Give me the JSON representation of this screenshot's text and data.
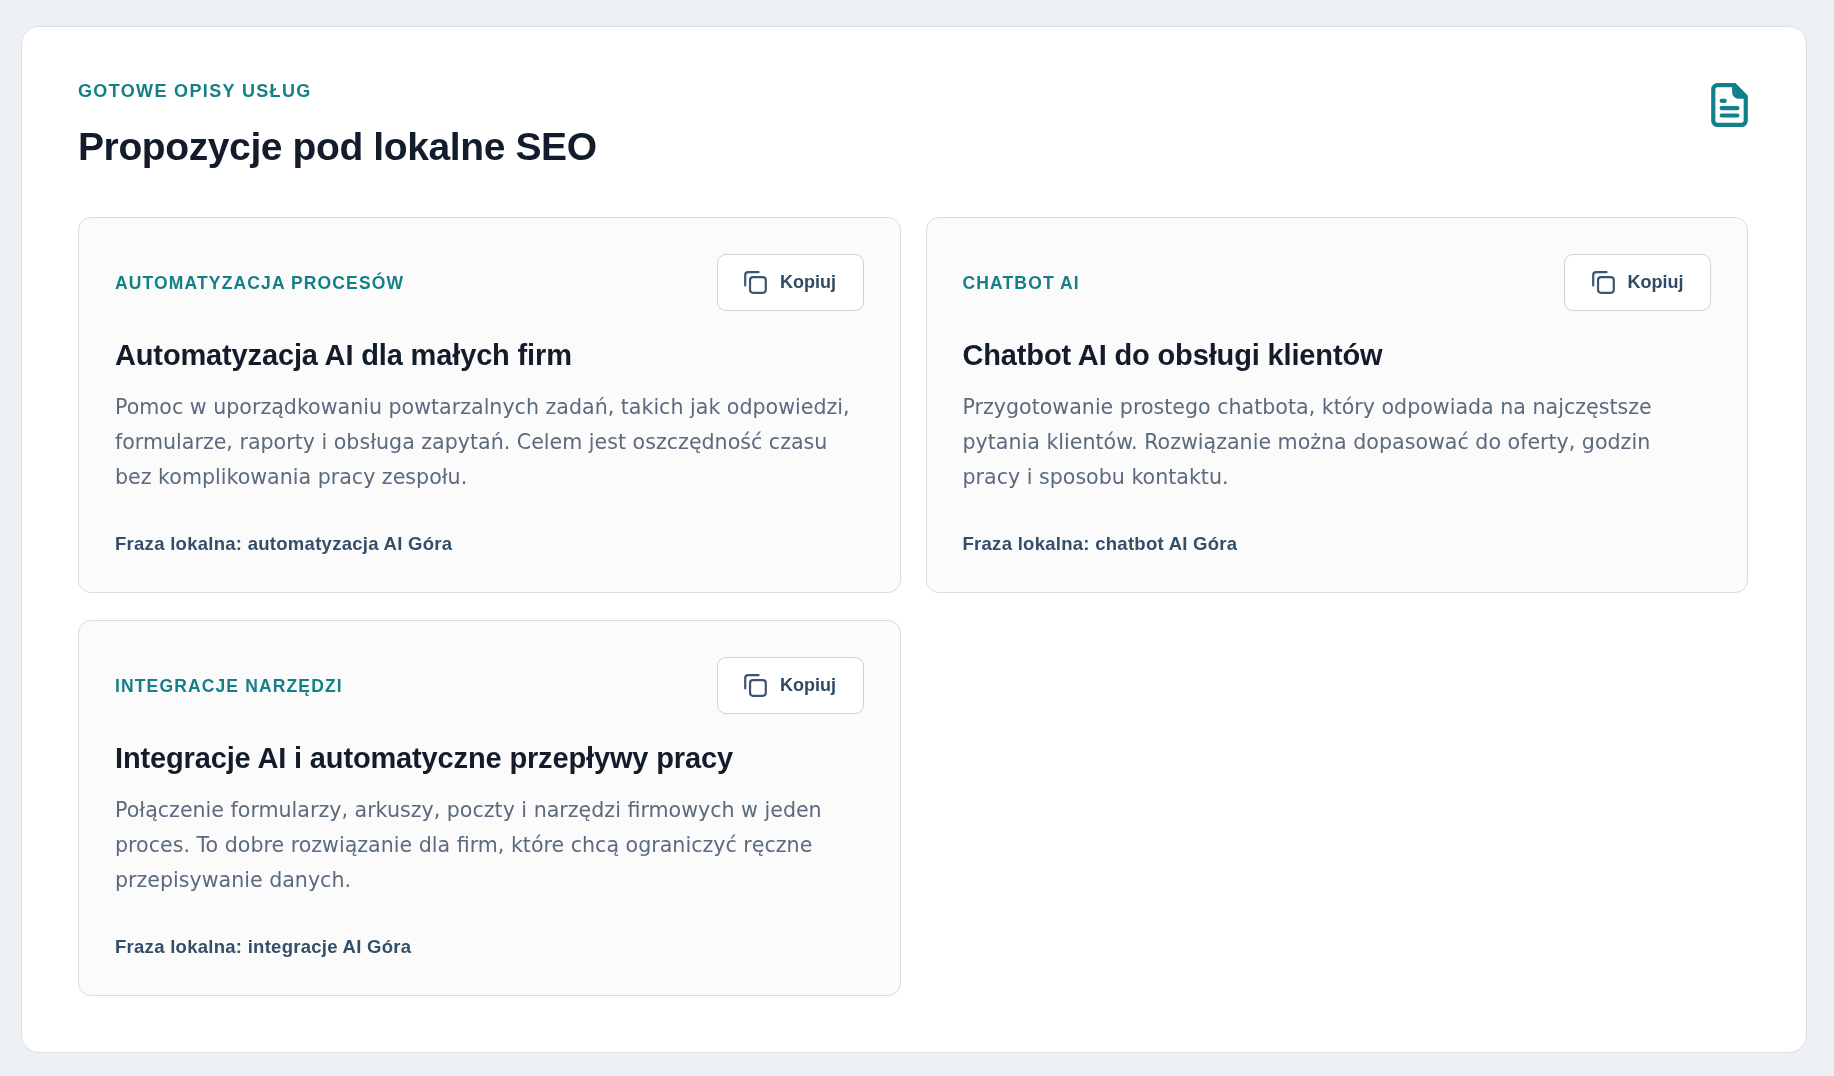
{
  "header": {
    "eyebrow": "GOTOWE OPISY USŁUG",
    "title": "Propozycje pod lokalne SEO"
  },
  "cards": [
    {
      "category": "AUTOMATYZACJA PROCESÓW",
      "button": "Kopiuj",
      "title": "Automatyzacja AI dla małych firm",
      "description": "Pomoc w uporządkowaniu powtarzalnych zadań, takich jak odpowiedzi, formularze, raporty i obsługa zapytań. Celem jest oszczędność czasu bez komplikowania pracy zespołu.",
      "phrase": "Fraza lokalna: automatyzacja AI Góra"
    },
    {
      "category": "CHATBOT AI",
      "button": "Kopiuj",
      "title": "Chatbot AI do obsługi klientów",
      "description": "Przygotowanie prostego chatbota, który odpowiada na najczęstsze pytania klientów. Rozwiązanie można dopasować do oferty, godzin pracy i sposobu kontaktu.",
      "phrase": "Fraza lokalna: chatbot AI Góra"
    },
    {
      "category": "INTEGRACJE NARZĘDZI",
      "button": "Kopiuj",
      "title": "Integracje AI i automatyczne przepływy pracy",
      "description": "Połączenie formularzy, arkuszy, poczty i narzędzi firmowych w jeden proces. To dobre rozwiązanie dla firm, które chcą ograniczyć ręczne przepisywanie danych.",
      "phrase": "Fraza lokalna: integracje AI Góra"
    }
  ]
}
